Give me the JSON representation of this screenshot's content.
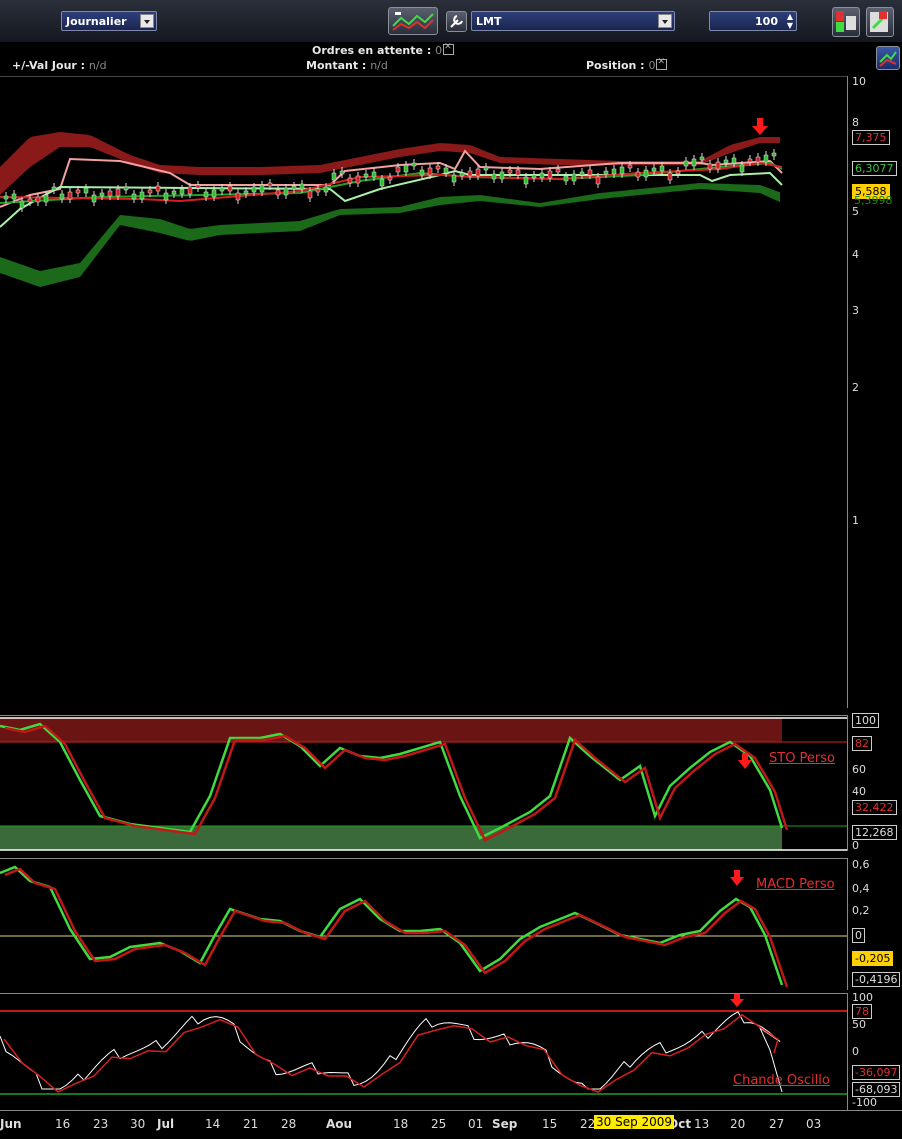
{
  "toolbar": {
    "period": "Journalier",
    "symbol": "LMT",
    "quantity": "100"
  },
  "info": {
    "pending_orders_label": "Ordres en attente :",
    "pending_orders_value": "0",
    "val_jour_label": "+/-Val Jour :",
    "val_jour_value": "n/d",
    "montant_label": "Montant :",
    "montant_value": "n/d",
    "position_label": "Position :",
    "position_value": "0"
  },
  "price_axis": {
    "ticks": [
      "10",
      "8",
      "5",
      "4",
      "3",
      "2",
      "1"
    ],
    "badges": {
      "upper": "7,375",
      "mid": "6,3077",
      "last": "5,588",
      "lower": "5,3998"
    }
  },
  "sto": {
    "name": "STO Perso",
    "ticks": [
      "100",
      "60",
      "40",
      "20",
      "0"
    ],
    "badges": {
      "upper": "82",
      "value": "32,422",
      "signal": "12,268"
    }
  },
  "macd": {
    "name": "MACD Perso",
    "ticks": [
      "0,6",
      "0,4",
      "0,2",
      "-0,2",
      "-0,4"
    ],
    "badges": {
      "zero": "0",
      "value": "-0,205",
      "signal": "-0,4196"
    }
  },
  "chande": {
    "name": "Chande Oscillo",
    "ticks": [
      "100",
      "50",
      "0",
      "-50",
      "-100"
    ],
    "badges": {
      "upper": "78",
      "value": "-36,097",
      "signal": "-68,093"
    }
  },
  "xaxis": {
    "labels": [
      {
        "t": "Jun",
        "b": true
      },
      {
        "t": "16",
        "b": false
      },
      {
        "t": "23",
        "b": false
      },
      {
        "t": "30",
        "b": false
      },
      {
        "t": "Jul",
        "b": true
      },
      {
        "t": "14",
        "b": false
      },
      {
        "t": "21",
        "b": false
      },
      {
        "t": "28",
        "b": false
      },
      {
        "t": "Aou",
        "b": true
      },
      {
        "t": "18",
        "b": false
      },
      {
        "t": "25",
        "b": false
      },
      {
        "t": "01",
        "b": false
      },
      {
        "t": "Sep",
        "b": true
      },
      {
        "t": "15",
        "b": false
      },
      {
        "t": "22",
        "b": false
      },
      {
        "t": "Oct",
        "b": true
      },
      {
        "t": "13",
        "b": false
      },
      {
        "t": "20",
        "b": false
      },
      {
        "t": "27",
        "b": false
      },
      {
        "t": "03",
        "b": false
      }
    ],
    "cursor_date": "30 Sep 2009"
  },
  "colors": {
    "up": "#2fbf2f",
    "down": "#d02020",
    "band_upper": "#8a1a1a",
    "band_lower": "#1a6a1a",
    "sto_high_zone": "#6a1414",
    "sto_low_zone": "#3a6a3a"
  }
}
